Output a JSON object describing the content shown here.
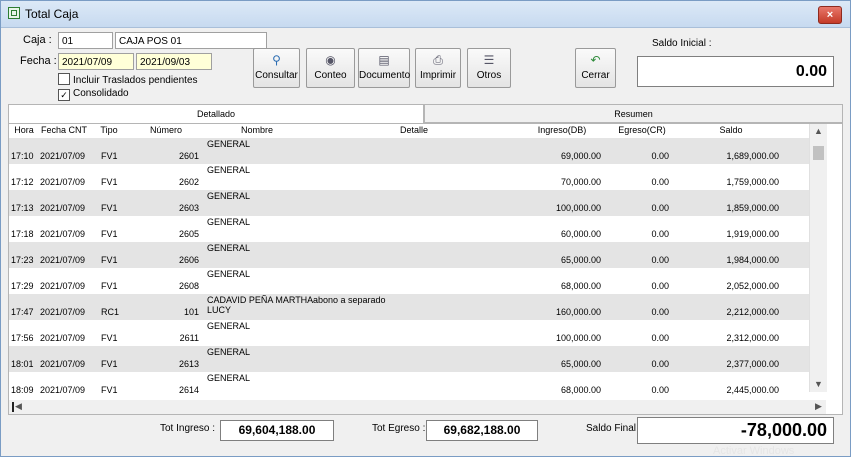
{
  "window": {
    "title": "Total Caja",
    "close_label": "×"
  },
  "filters": {
    "caja_label": "Caja :",
    "caja_code": "01",
    "caja_name": "CAJA POS 01",
    "fecha_label": "Fecha :",
    "fecha_desde": "2021/07/09",
    "fecha_hasta": "2021/09/03",
    "incluir_traslados_label": "Incluir Traslados pendientes",
    "incluir_traslados_checked": false,
    "consolidado_label": "Consolidado",
    "consolidado_checked": true,
    "consolidado_mark": "✓"
  },
  "toolbar": {
    "consultar": "Consultar",
    "conteo": "Conteo",
    "documento": "Documento",
    "imprimir": "Imprimir",
    "otros": "Otros",
    "cerrar": "Cerrar",
    "icons": {
      "consultar": "magnifier-icon",
      "conteo": "coins-icon",
      "documento": "document-icon",
      "imprimir": "printer-icon",
      "otros": "list-icon",
      "cerrar": "return-arrow-icon"
    }
  },
  "saldo_inicial": {
    "label": "Saldo Inicial :",
    "value": "0.00"
  },
  "tabs": [
    {
      "label": "Detallado",
      "active": true
    },
    {
      "label": "Resumen",
      "active": false
    }
  ],
  "table": {
    "columns": [
      "Hora",
      "Fecha CNT",
      "Tipo",
      "Número",
      "Nombre",
      "Detalle",
      "Ingreso(DB)",
      "Egreso(CR)",
      "Saldo"
    ],
    "rows": [
      {
        "hora": "17:10",
        "fecha": "2021/07/09",
        "tipo": "FV1",
        "numero": "2601",
        "nombre": "GENERAL",
        "nombre2": "",
        "detalle": "",
        "ingreso": "69,000.00",
        "egreso": "0.00",
        "saldo": "1,689,000.00"
      },
      {
        "hora": "17:12",
        "fecha": "2021/07/09",
        "tipo": "FV1",
        "numero": "2602",
        "nombre": "GENERAL",
        "nombre2": "",
        "detalle": "",
        "ingreso": "70,000.00",
        "egreso": "0.00",
        "saldo": "1,759,000.00"
      },
      {
        "hora": "17:13",
        "fecha": "2021/07/09",
        "tipo": "FV1",
        "numero": "2603",
        "nombre": "GENERAL",
        "nombre2": "",
        "detalle": "",
        "ingreso": "100,000.00",
        "egreso": "0.00",
        "saldo": "1,859,000.00"
      },
      {
        "hora": "17:18",
        "fecha": "2021/07/09",
        "tipo": "FV1",
        "numero": "2605",
        "nombre": "GENERAL",
        "nombre2": "",
        "detalle": "",
        "ingreso": "60,000.00",
        "egreso": "0.00",
        "saldo": "1,919,000.00"
      },
      {
        "hora": "17:23",
        "fecha": "2021/07/09",
        "tipo": "FV1",
        "numero": "2606",
        "nombre": "GENERAL",
        "nombre2": "",
        "detalle": "",
        "ingreso": "65,000.00",
        "egreso": "0.00",
        "saldo": "1,984,000.00"
      },
      {
        "hora": "17:29",
        "fecha": "2021/07/09",
        "tipo": "FV1",
        "numero": "2608",
        "nombre": "GENERAL",
        "nombre2": "",
        "detalle": "",
        "ingreso": "68,000.00",
        "egreso": "0.00",
        "saldo": "2,052,000.00"
      },
      {
        "hora": "17:47",
        "fecha": "2021/07/09",
        "tipo": "RC1",
        "numero": "101",
        "nombre": "CADAVID PEÑA MARTHA",
        "nombre2": "LUCY",
        "detalle": "abono a separado",
        "ingreso": "160,000.00",
        "egreso": "0.00",
        "saldo": "2,212,000.00"
      },
      {
        "hora": "17:56",
        "fecha": "2021/07/09",
        "tipo": "FV1",
        "numero": "2611",
        "nombre": "GENERAL",
        "nombre2": "",
        "detalle": "",
        "ingreso": "100,000.00",
        "egreso": "0.00",
        "saldo": "2,312,000.00"
      },
      {
        "hora": "18:01",
        "fecha": "2021/07/09",
        "tipo": "FV1",
        "numero": "2613",
        "nombre": "GENERAL",
        "nombre2": "",
        "detalle": "",
        "ingreso": "65,000.00",
        "egreso": "0.00",
        "saldo": "2,377,000.00"
      },
      {
        "hora": "18:09",
        "fecha": "2021/07/09",
        "tipo": "FV1",
        "numero": "2614",
        "nombre": "GENERAL",
        "nombre2": "",
        "detalle": "",
        "ingreso": "68,000.00",
        "egreso": "0.00",
        "saldo": "2,445,000.00"
      }
    ]
  },
  "scrollbars": {
    "up": "▲",
    "down": "▼",
    "left": "◀",
    "right": "▶"
  },
  "totals": {
    "ingreso_label": "Tot Ingreso :",
    "ingreso_value": "69,604,188.00",
    "egreso_label": "Tot Egreso :",
    "egreso_value": "69,682,188.00",
    "saldo_final_label": "Saldo Final :",
    "saldo_final_value": "-78,000.00"
  },
  "watermark": "Activar Windows"
}
